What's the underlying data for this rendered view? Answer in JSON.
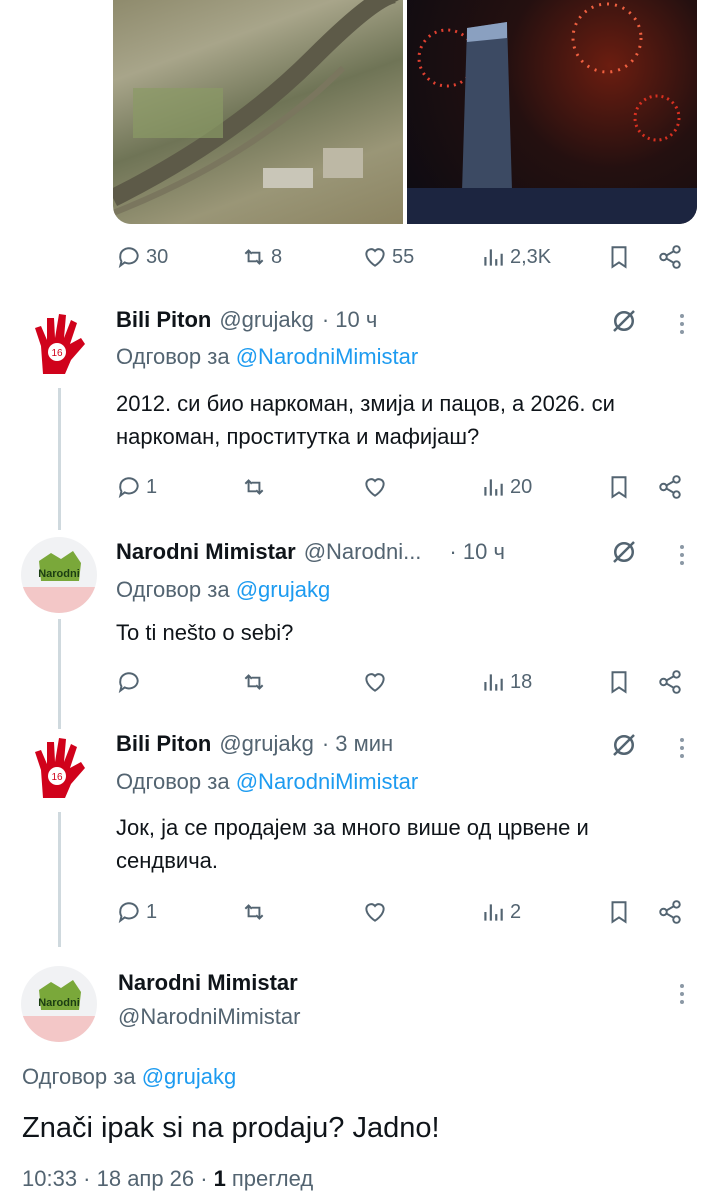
{
  "top_post": {
    "stats": {
      "replies": "30",
      "reposts": "8",
      "likes": "55",
      "views": "2,3K"
    }
  },
  "replies": [
    {
      "avatar_label": "16",
      "name": "Bili Piton",
      "handle": "@grujakg",
      "time": "· 10 ч",
      "reply_prefix": "Одговор за",
      "reply_to": "@NarodniMimistar",
      "text": "2012. си био наркоман, змија и пацов, а 2026. си наркоман, проститутка и мафијаш?",
      "stats": {
        "replies": "1",
        "reposts": "",
        "likes": "",
        "views": "20"
      }
    },
    {
      "avatar_label": "Narodni",
      "name": "Narodni Mimistar",
      "handle": "@Narodni...",
      "time": "· 10 ч",
      "reply_prefix": "Одговор за",
      "reply_to": "@grujakg",
      "text": "To ti nešto o sebi?",
      "stats": {
        "replies": "",
        "reposts": "",
        "likes": "",
        "views": "18"
      }
    },
    {
      "avatar_label": "16",
      "name": "Bili Piton",
      "handle": "@grujakg",
      "time": "· 3 мин",
      "reply_prefix": "Одговор за",
      "reply_to": "@NarodniMimistar",
      "text": "Јок, ја се продајем за много више од црвене и сендвича.",
      "stats": {
        "replies": "1",
        "reposts": "",
        "likes": "",
        "views": "2"
      }
    }
  ],
  "focused": {
    "avatar_label": "Narodni",
    "name": "Narodni Mimistar",
    "handle": "@NarodniMimistar",
    "reply_prefix": "Одговор за",
    "reply_to": "@grujakg",
    "text": "Znači ipak si na prodaju? Jadno!",
    "time": "10:33 · 18 апр 26 ·",
    "views_count": "1",
    "views_label": "преглед"
  },
  "colors": {
    "link": "#1d9bf0",
    "gray": "#536471",
    "accent_red": "#d0021b"
  }
}
